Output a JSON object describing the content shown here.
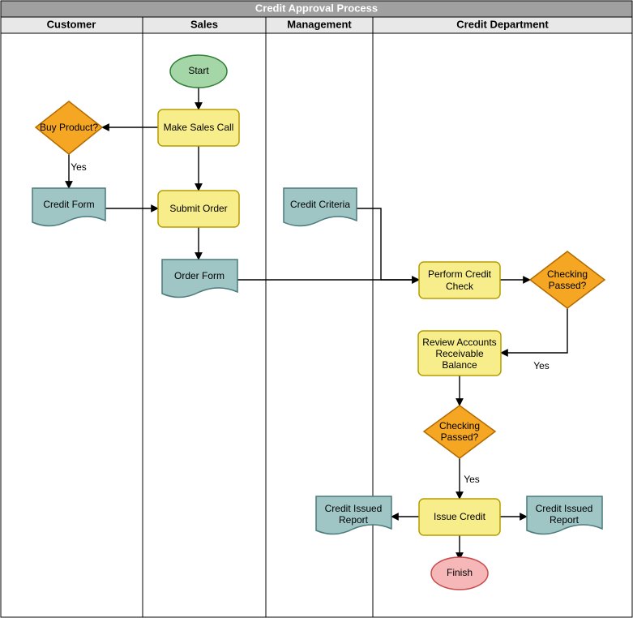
{
  "title": "Credit Approval Process",
  "lanes": {
    "customer": "Customer",
    "sales": "Sales",
    "management": "Management",
    "credit": "Credit Department"
  },
  "nodes": {
    "start": "Start",
    "make_sales_call": "Make Sales Call",
    "buy_product": "Buy Product?",
    "credit_form": "Credit Form",
    "submit_order": "Submit Order",
    "order_form": "Order Form",
    "credit_criteria": "Credit Criteria",
    "perform_credit_check_l1": "Perform Credit",
    "perform_credit_check_l2": "Check",
    "checking_passed_1_l1": "Checking",
    "checking_passed_1_l2": "Passed?",
    "review_ar_l1": "Review Accounts",
    "review_ar_l2": "Receivable",
    "review_ar_l3": "Balance",
    "checking_passed_2_l1": "Checking",
    "checking_passed_2_l2": "Passed?",
    "issue_credit": "Issue Credit",
    "credit_issued_report_left_l1": "Credit Issued",
    "credit_issued_report_left_l2": "Report",
    "credit_issued_report_right_l1": "Credit Issued",
    "credit_issued_report_right_l2": "Report",
    "finish": "Finish"
  },
  "edge_labels": {
    "yes1": "Yes",
    "yes2": "Yes",
    "yes3": "Yes"
  }
}
